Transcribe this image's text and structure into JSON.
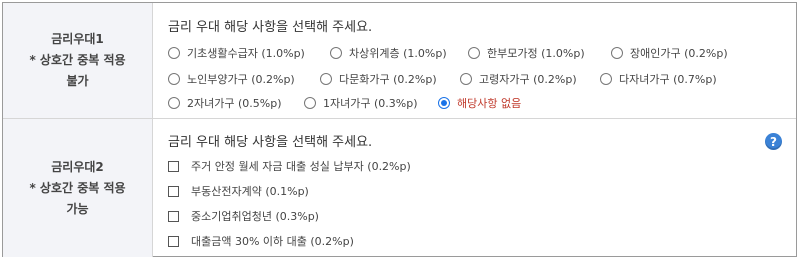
{
  "section1": {
    "label": [
      "금리우대1",
      "* 상호간 중복 적용",
      "불가"
    ],
    "question": "금리 우대 해당 사항을 선택해 주세요.",
    "options": [
      "기초생활수급자 (1.0%p)",
      "차상위계층 (1.0%p)",
      "한부모가정 (1.0%p)",
      "장애인가구 (0.2%p)",
      "노인부양가구 (0.2%p)",
      "다문화가구 (0.2%p)",
      "고령자가구 (0.2%p)",
      "다자녀가구 (0.7%p)",
      "2자녀가구 (0.5%p)",
      "1자녀가구 (0.3%p)",
      "해당사항 없음"
    ],
    "selected": "해당사항 없음"
  },
  "section2": {
    "label": [
      "금리우대2",
      "* 상호간 중복 적용",
      "가능"
    ],
    "question": "금리 우대 해당 사항을 선택해 주세요.",
    "options": [
      "주거 안정 월세 자금 대출 성실 납부자 (0.2%p)",
      "부동산전자계약 (0.1%p)",
      "중소기업취업청년 (0.3%p)",
      "대출금액 30% 이하 대출 (0.2%p)"
    ],
    "checked": []
  },
  "help_icon": {
    "glyph": "?"
  },
  "colors": {
    "label_bg": "#f3f4f8",
    "accent": "#1a73e8",
    "selected_text": "#c0392b"
  }
}
